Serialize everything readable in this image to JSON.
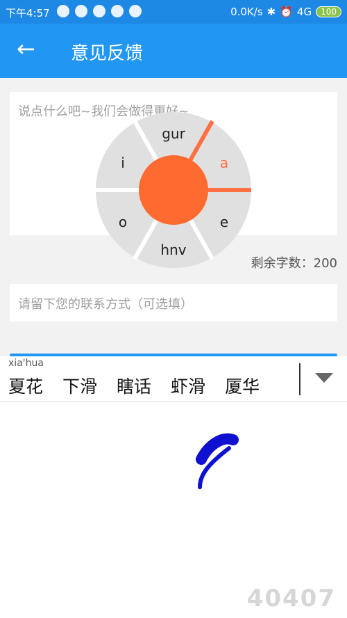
{
  "status_bar": {
    "time": "下午4:57",
    "network_speed": "0.0K/s",
    "signal": "4G",
    "battery": "100"
  },
  "app_bar": {
    "back_icon": "arrow-left-icon",
    "title": "意见反馈"
  },
  "feedback": {
    "placeholder": "说点什么吧~我们会做得更好~",
    "remaining_label": "剩余字数：200"
  },
  "contact": {
    "placeholder": "请留下您的联系方式（可选填）"
  },
  "input_method": {
    "pinyin": "xia'hua",
    "candidates": [
      "夏花",
      "下滑",
      "瞎话",
      "虾滑",
      "厦华"
    ],
    "expand_icon": "triangle-down-icon"
  },
  "handwriting_wheel": {
    "keys": [
      "gur",
      "a",
      "e",
      "hnv",
      "o",
      "i"
    ],
    "active_key": "a",
    "colors": {
      "active": "#ff7043",
      "center": "#ff6a30",
      "sector": "#e0e0e0"
    }
  },
  "watermark": "40407"
}
